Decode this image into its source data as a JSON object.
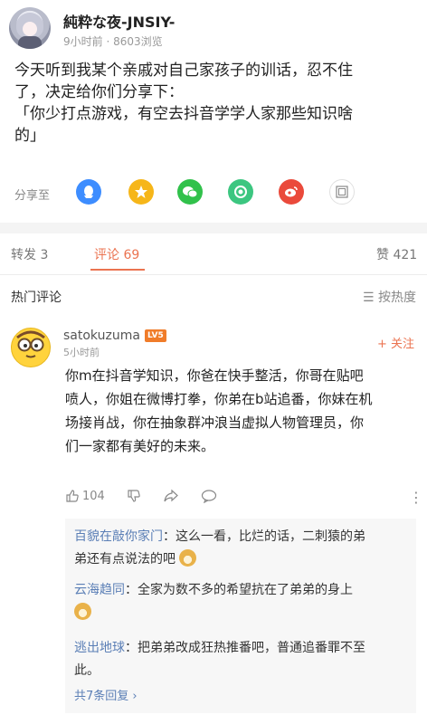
{
  "post": {
    "author": "純粋な夜-JNSIY-",
    "meta": "9小时前 · 8603浏览",
    "lines": [
      "今天听到我某个亲戚对自己家孩子的训话，忍不住",
      "了，决定给你们分享下：",
      "「你少打点游戏，有空去抖音学学人家那些知识啥",
      "的」"
    ]
  },
  "share": {
    "label": "分享至",
    "icons": [
      {
        "name": "qq-icon",
        "color": "#3d8dff"
      },
      {
        "name": "qzone-icon",
        "color": "#f6b619"
      },
      {
        "name": "wechat-icon",
        "color": "#31c14b"
      },
      {
        "name": "moments-icon",
        "color": "#3cc680"
      },
      {
        "name": "weibo-icon",
        "color": "#ea4a3b"
      },
      {
        "name": "gallery-icon",
        "color": "#ffffff"
      }
    ]
  },
  "tabs": {
    "repost": "转发  3",
    "comment": "评论  69",
    "like": "赞  421"
  },
  "hot": {
    "title": "热门评论",
    "sort": "☰ 按热度"
  },
  "comment": {
    "author": "satokuzuma",
    "badge": "LV5",
    "time": "5小时前",
    "follow": "+ 关注",
    "lines": [
      "你m在抖音学知识，你爸在快手整活，你哥在贴吧",
      "喷人，你姐在微博打拳，你弟在b站追番，你妹在机",
      "场接肖战，你在抽象群冲浪当虚拟人物管理员，你",
      "们一家都有美好的未来。"
    ],
    "likes": "104",
    "more": "⋮"
  },
  "replies": [
    {
      "name": "百貌在敲你家门",
      "lines": [
        "：这么一看，比烂的话，二刺猿的弟",
        "弟还有点说法的吧"
      ]
    },
    {
      "name": "云海趋同",
      "lines": [
        "：全家为数不多的希望抗在了弟弟的身上",
        ""
      ]
    },
    {
      "name": "逃出地球",
      "lines": [
        "：把弟弟改成狂热推番吧，普通追番罪不至",
        "此。"
      ]
    }
  ],
  "more_replies": "共7条回复 ›"
}
